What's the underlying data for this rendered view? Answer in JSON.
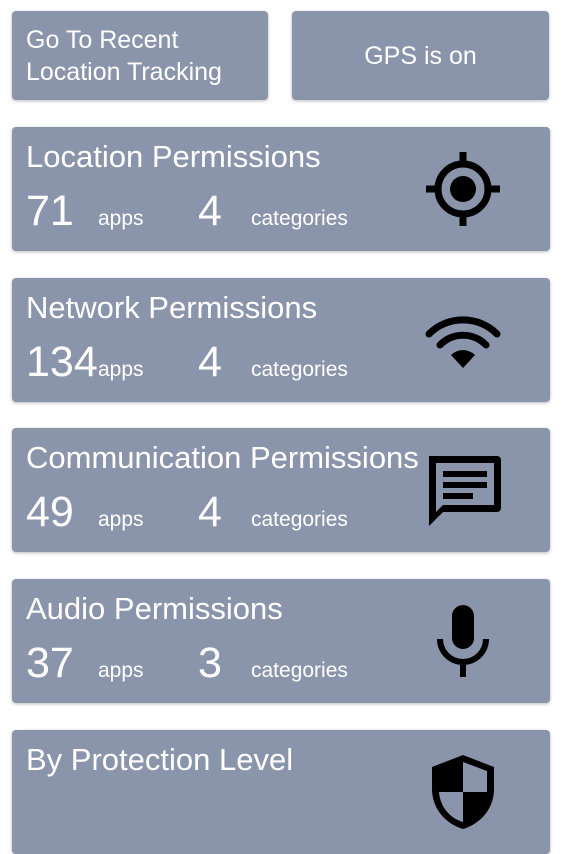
{
  "top_buttons": {
    "recent_tracking_label": "Go To Recent\nLocation Tracking",
    "gps_status_label": "GPS is on"
  },
  "permissions": [
    {
      "title": "Location Permissions",
      "apps_count": "71",
      "apps_label": "apps",
      "categories_count": "4",
      "categories_label": "categories",
      "icon": "location-target-icon"
    },
    {
      "title": "Network Permissions",
      "apps_count": "134",
      "apps_label": "apps",
      "categories_count": "4",
      "categories_label": "categories",
      "icon": "wifi-icon"
    },
    {
      "title": "Communication Permissions",
      "apps_count": "49",
      "apps_label": "apps",
      "categories_count": "4",
      "categories_label": "categories",
      "icon": "message-icon"
    },
    {
      "title": "Audio Permissions",
      "apps_count": "37",
      "apps_label": "apps",
      "categories_count": "3",
      "categories_label": "categories",
      "icon": "microphone-icon"
    },
    {
      "title": "By Protection Level",
      "icon": "shield-icon"
    }
  ],
  "colors": {
    "card_background": "#8a95ab",
    "text": "#ffffff",
    "icon": "#000000"
  }
}
